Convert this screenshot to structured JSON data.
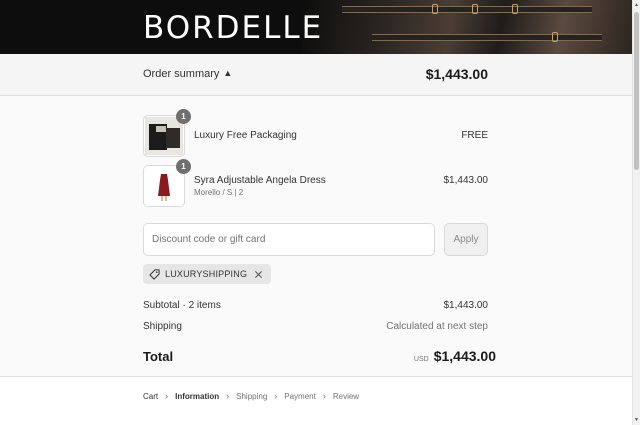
{
  "header": {
    "logo_text": "BORDELLE"
  },
  "summary_bar": {
    "toggle_label": "Order summary",
    "total": "$1,443.00"
  },
  "line_items": [
    {
      "title": "Luxury Free Packaging",
      "variant": "",
      "price": "FREE",
      "quantity": "1"
    },
    {
      "title": "Syra Adjustable Angela Dress",
      "variant": "Morello / S | 2",
      "price": "$1,443.00",
      "quantity": "1"
    }
  ],
  "discount": {
    "placeholder": "Discount code or gift card",
    "apply_label": "Apply",
    "applied_code": "LUXURYSHIPPING"
  },
  "totals": {
    "subtotal_label": "Subtotal · 2 items",
    "subtotal_value": "$1,443.00",
    "shipping_label": "Shipping",
    "shipping_value": "Calculated at next step",
    "total_label": "Total",
    "currency": "USD",
    "total_value": "$1,443.00"
  },
  "breadcrumb": {
    "cart": "Cart",
    "information": "Information",
    "shipping": "Shipping",
    "payment": "Payment",
    "review": "Review"
  },
  "colors": {
    "summary_background": "#f5f5f5",
    "panel_background": "#fafafa",
    "tag_background": "#e6e6e6",
    "quantity_badge": "#6f6f6f"
  }
}
